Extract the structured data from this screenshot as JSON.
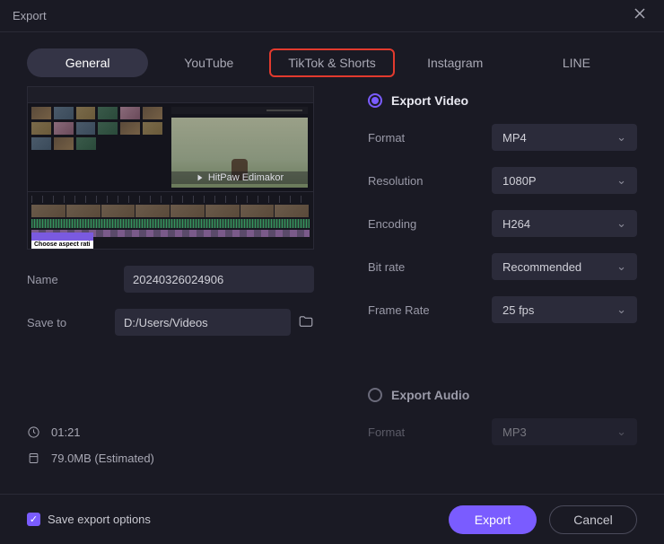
{
  "titlebar": {
    "title": "Export"
  },
  "tabs": {
    "items": [
      "General",
      "YouTube",
      "TikTok & Shorts",
      "Instagram",
      "LINE"
    ],
    "active": 0,
    "highlighted": 2
  },
  "preview": {
    "watermark": "HitPaw Edimakor",
    "aspect_label": "Choose aspect rati"
  },
  "left_form": {
    "name_label": "Name",
    "name_value": "20240326024906",
    "saveto_label": "Save to",
    "saveto_value": "D:/Users/Videos"
  },
  "stats": {
    "duration": "01:21",
    "filesize": "79.0MB (Estimated)"
  },
  "video_section": {
    "title": "Export Video",
    "selected": true,
    "fields": {
      "format": {
        "label": "Format",
        "value": "MP4"
      },
      "resolution": {
        "label": "Resolution",
        "value": "1080P"
      },
      "encoding": {
        "label": "Encoding",
        "value": "H264"
      },
      "bitrate": {
        "label": "Bit rate",
        "value": "Recommended"
      },
      "framerate": {
        "label": "Frame Rate",
        "value": "25  fps"
      }
    }
  },
  "audio_section": {
    "title": "Export Audio",
    "selected": false,
    "fields": {
      "format": {
        "label": "Format",
        "value": "MP3"
      }
    }
  },
  "footer": {
    "save_options_label": "Save export options",
    "save_options_checked": true,
    "export_label": "Export",
    "cancel_label": "Cancel"
  }
}
